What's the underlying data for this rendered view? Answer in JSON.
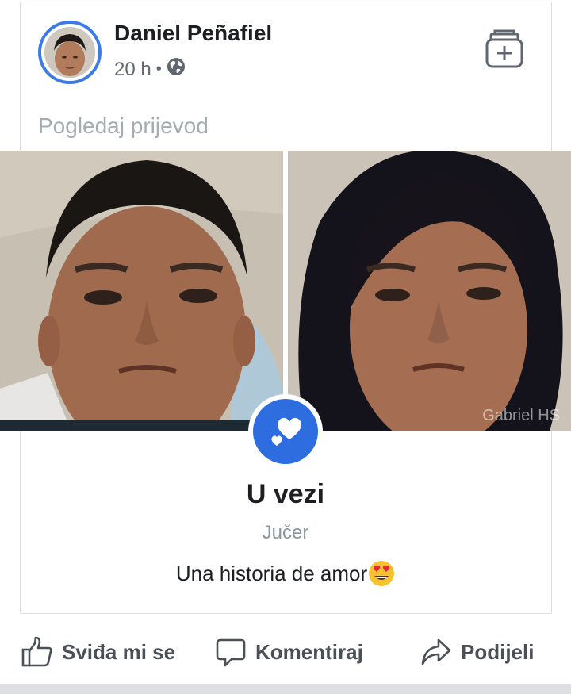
{
  "post": {
    "author": "Daniel Peñafiel",
    "time": "20 h",
    "separator": "•",
    "audience_icon": "globe-icon",
    "save_icon": "add-collection-icon",
    "translate_label": "Pogledaj prijevod"
  },
  "life_event": {
    "icon": "hearts-icon",
    "title": "U vezi",
    "date": "Jučer",
    "text": "Una historia de amor",
    "emoji": "heart-eyes-emoji"
  },
  "photos": {
    "watermark": "Gabriel HS"
  },
  "actions": {
    "like": "Sviđa mi se",
    "comment": "Komentiraj",
    "share": "Podijeli"
  },
  "colors": {
    "accent": "#2d6de0",
    "avatar_ring": "#3b7be8",
    "text": "#1c1e21",
    "muted": "#606770"
  }
}
